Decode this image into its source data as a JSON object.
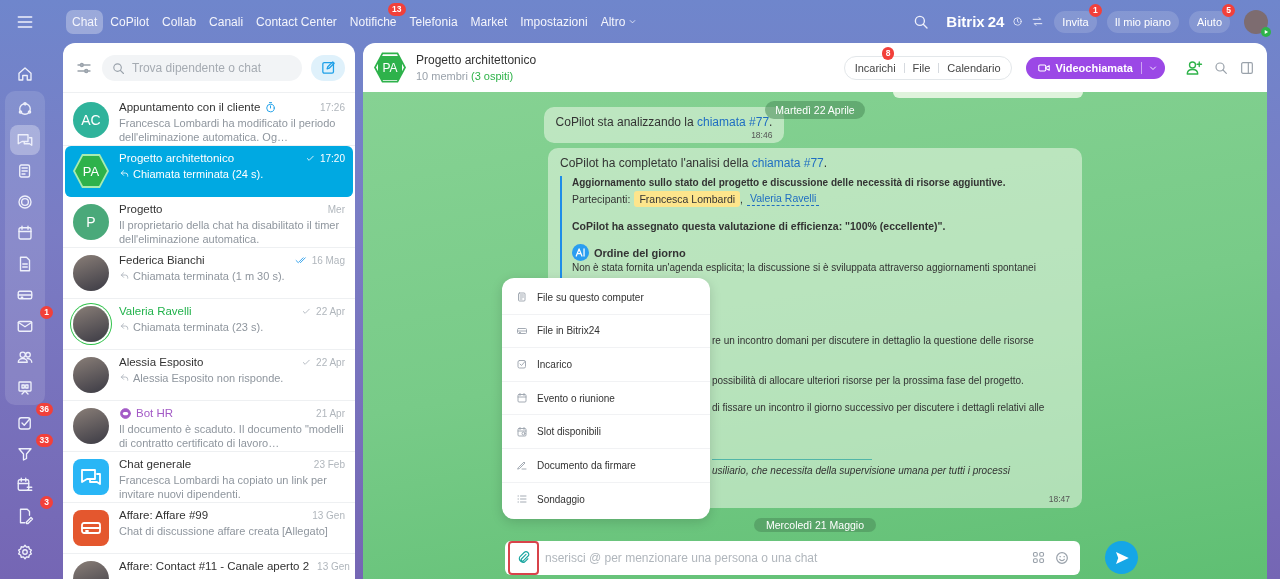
{
  "top_nav": {
    "tabs": [
      {
        "label": "Chat",
        "selected": true,
        "dropdown": false
      },
      {
        "label": "CoPilot",
        "selected": false,
        "dropdown": false
      },
      {
        "label": "Collab",
        "selected": false,
        "dropdown": false
      },
      {
        "label": "Canali",
        "selected": false,
        "dropdown": false
      },
      {
        "label": "Contact Center",
        "selected": false,
        "dropdown": false
      },
      {
        "label": "Notifiche",
        "selected": false,
        "dropdown": false,
        "badge": "13"
      },
      {
        "label": "Telefonia",
        "selected": false,
        "dropdown": false
      },
      {
        "label": "Market",
        "selected": false,
        "dropdown": false
      },
      {
        "label": "Impostazioni",
        "selected": false,
        "dropdown": false
      },
      {
        "label": "Altro",
        "selected": false,
        "dropdown": true
      }
    ]
  },
  "top_right": {
    "logo": "Bitrix",
    "logo_number": "24",
    "buttons": [
      {
        "label": "Invita",
        "badge": "1"
      },
      {
        "label": "Il mio piano"
      },
      {
        "label": "Aiuto",
        "badge": "5"
      }
    ]
  },
  "rail": {
    "items": [
      {
        "selected": false
      },
      {
        "selected": false
      },
      {
        "selected": true
      },
      {
        "selected": false
      },
      {
        "selected": false
      },
      {
        "selected": false
      },
      {
        "selected": false
      },
      {
        "selected": false
      },
      {
        "selected": false,
        "badge": "1"
      },
      {
        "selected": false
      },
      {
        "selected": false
      },
      {
        "selected": false,
        "badge": "36"
      },
      {
        "selected": false,
        "badge": "33"
      },
      {
        "selected": false
      },
      {
        "selected": false,
        "badge": "3"
      }
    ]
  },
  "chat_list": {
    "search": {
      "placeholder": "Trova dipendente o chat"
    },
    "items": [
      {
        "avatar": {
          "kind": "initials",
          "text": "AC",
          "color": "#2fb39b"
        },
        "name": "Appuntamento con il cliente",
        "bot": false,
        "timer": true,
        "time": "17:26",
        "sent": false,
        "read": false,
        "call_arrow": false,
        "preview": "Francesca Lombardi ha modificato il periodo dell'eliminazione automatica. Og…",
        "selected": false
      },
      {
        "avatar": {
          "kind": "hexagon",
          "text": "PA",
          "color": "#2eb24b"
        },
        "name": "Progetto architettonico",
        "bot": false,
        "timer": false,
        "time": "17:20",
        "sent": true,
        "read": false,
        "call_arrow": true,
        "preview": "Chiamata terminata (24 s).",
        "selected": true
      },
      {
        "avatar": {
          "kind": "initials",
          "text": "P",
          "color": "#4aa97a"
        },
        "name": "Progetto",
        "bot": false,
        "timer": false,
        "time": "Mer",
        "sent": false,
        "read": false,
        "call_arrow": false,
        "preview": "Il proprietario della chat ha disabilitato il timer dell'eliminazione automatica.",
        "selected": false
      },
      {
        "avatar": {
          "kind": "photo"
        },
        "name": "Federica Bianchi",
        "online": false,
        "bot": false,
        "timer": false,
        "time": "16 Mag",
        "sent": false,
        "read": true,
        "call_arrow": true,
        "preview": "Chiamata terminata (1 m 30 s).",
        "selected": false
      },
      {
        "avatar": {
          "kind": "photo"
        },
        "name": "Valeria Ravelli",
        "online": true,
        "bot": false,
        "timer": false,
        "time": "22 Apr",
        "sent": true,
        "read": false,
        "call_arrow": true,
        "preview": "Chiamata terminata (23 s).",
        "selected": false
      },
      {
        "avatar": {
          "kind": "photo"
        },
        "name": "Alessia Esposito",
        "online": false,
        "bot": false,
        "timer": false,
        "time": "22 Apr",
        "sent": true,
        "read": false,
        "call_arrow": true,
        "preview": "Alessia Esposito non risponde.",
        "selected": false
      },
      {
        "avatar": {
          "kind": "photo"
        },
        "name": "Bot HR",
        "online": false,
        "bot": true,
        "timer": false,
        "time": "21 Apr",
        "sent": false,
        "read": false,
        "call_arrow": false,
        "preview": "Il documento è scaduto. Il documento \"modelli di contratto certificato di lavoro…",
        "selected": false
      },
      {
        "avatar": {
          "kind": "groupchat",
          "color": "#29b6f6"
        },
        "name": "Chat generale",
        "bot": false,
        "timer": false,
        "time": "23 Feb",
        "sent": false,
        "read": false,
        "call_arrow": false,
        "preview": "Francesca Lombardi ha copiato un link per invitare nuovi dipendenti.",
        "selected": false
      },
      {
        "avatar": {
          "kind": "deal",
          "color": "#e4572e"
        },
        "name": "Affare: Affare #99",
        "bot": false,
        "timer": false,
        "time": "13 Gen",
        "sent": false,
        "read": false,
        "call_arrow": false,
        "preview": "Chat di discussione affare creata [Allegato]",
        "selected": false
      },
      {
        "avatar": {
          "kind": "photo"
        },
        "name": "Affare: Contact #11 - Canale aperto 2",
        "online": false,
        "bot": false,
        "timer": false,
        "time": "13 Gen",
        "sent": false,
        "read": false,
        "selected": false
      }
    ]
  },
  "chat": {
    "avatar": "PA",
    "title": "Progetto architettonico",
    "members": "10 membri",
    "guests": "(3 ospiti)",
    "tabs": [
      {
        "label": "Incarichi",
        "badge": "8"
      },
      {
        "label": "File"
      },
      {
        "label": "Calendario"
      }
    ],
    "call_button": "Videochiamata",
    "messages": [
      {
        "kind": "date",
        "text": "Martedì 22 Aprile"
      },
      {
        "kind": "text",
        "text": "CoPilot sta analizzando la ",
        "link": "chiamata #77",
        "after": ".",
        "time": "18:46"
      },
      {
        "kind": "report",
        "intro": "CoPilot ha completato l'analisi della ",
        "link": "chiamata #77",
        "after": ".",
        "heading": "Aggiornamento sullo stato del progetto e discussione delle necessità di risorse aggiuntive.",
        "participants_label": "Partecipanti:",
        "participant_separator": ",",
        "participants": [
          {
            "name": "Francesca Lombardi",
            "highlighted": true
          },
          {
            "name": "Valeria Ravelli",
            "highlighted": false
          }
        ],
        "rating": "CoPilot ha assegnato questa valutazione di efficienza: \"100% (eccellente)\".",
        "section_title": "Ordine del giorno",
        "section_text": "Non è stata fornita un'agenda esplicita; la discussione si è sviluppata attraverso aggiornamenti spontanei",
        "fragments": [
          {
            "text": "re un incontro domani per discutere in dettaglio la questione delle risorse",
            "italic": false,
            "rule_before": false
          },
          {
            "text": "possibilità di allocare ulteriori risorse per la prossima fase del progetto.",
            "italic": false,
            "rule_before": false
          },
          {
            "text": "di fissare un incontro il giorno successivo per discutere i dettagli relativi alle",
            "italic": false,
            "rule_before": false
          },
          {
            "text": "usiliario, che necessita della supervisione umana per tutti i processi",
            "italic": true,
            "rule_before": true
          }
        ],
        "time": "18:47"
      },
      {
        "kind": "date",
        "text": "Mercoledì 21 Maggio"
      }
    ],
    "attach_menu": {
      "items": [
        {
          "label": "File su questo computer"
        },
        {
          "label": "File in Bitrix24"
        },
        {
          "label": "Incarico"
        },
        {
          "label": "Evento o riunione"
        },
        {
          "label": "Slot disponibili"
        },
        {
          "label": "Documento da firmare"
        },
        {
          "label": "Sondaggio"
        }
      ]
    },
    "composer": {
      "placeholder": "nserisci @ per menzionare una persona o una chat"
    }
  }
}
